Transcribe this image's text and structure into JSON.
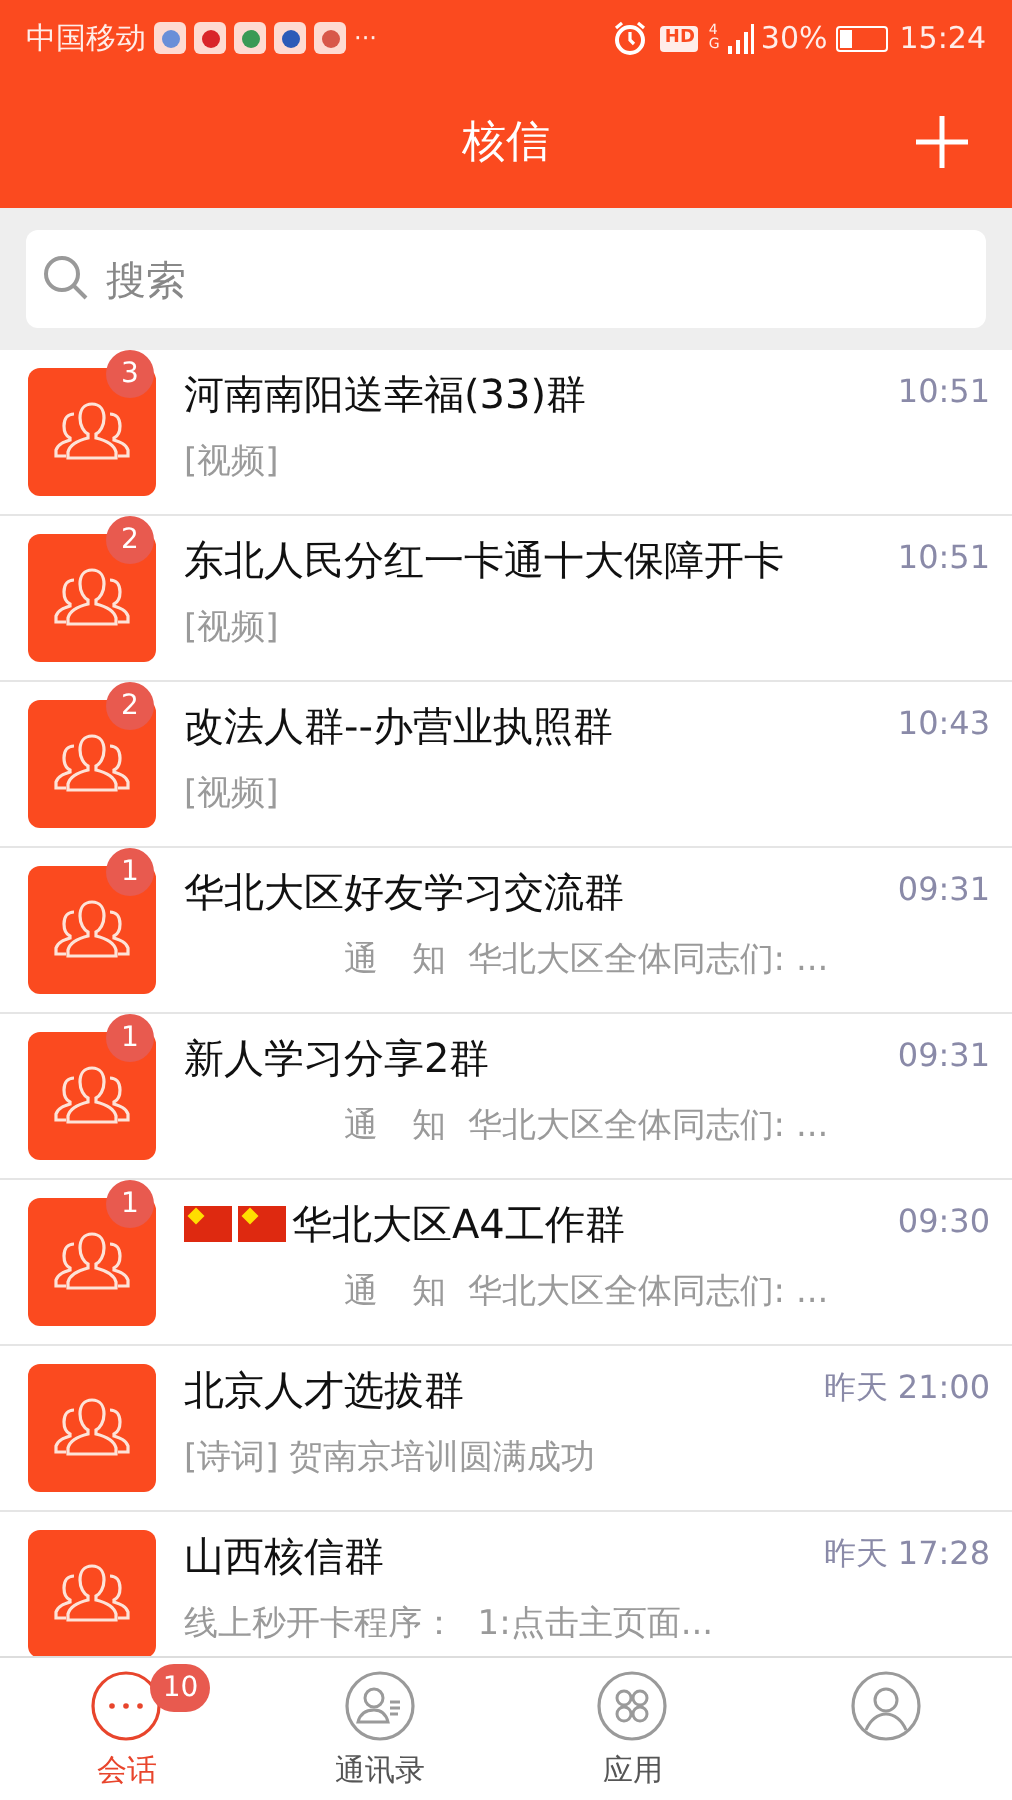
{
  "status_bar": {
    "carrier": "中国移动",
    "more": "···",
    "hd": "HD",
    "network": "4G",
    "battery_text": "30%",
    "time": "15:24"
  },
  "header": {
    "title": "核信"
  },
  "search": {
    "placeholder": "搜索"
  },
  "chats": [
    {
      "title": "河南南阳送幸福(33)群",
      "time": "10:51",
      "preview": "[视频]",
      "unread": "3",
      "flagged": false,
      "kind": "normal"
    },
    {
      "title": "东北人民分红一卡通十大保障开卡",
      "time": "10:51",
      "preview": "[视频]",
      "unread": "2",
      "flagged": false,
      "kind": "normal"
    },
    {
      "title": "改法人群--办营业执照群",
      "time": "10:43",
      "preview": "[视频]",
      "unread": "2",
      "flagged": false,
      "kind": "normal"
    },
    {
      "title": "华北大区好友学习交流群",
      "time": "09:31",
      "preview": "通　知  华北大区全体同志们: ...",
      "unread": "1",
      "flagged": false,
      "kind": "notice"
    },
    {
      "title": "新人学习分享2群",
      "time": "09:31",
      "preview": "通　知  华北大区全体同志们: ...",
      "unread": "1",
      "flagged": false,
      "kind": "notice"
    },
    {
      "title": "华北大区A4工作群",
      "time": "09:30",
      "preview": "通　知  华北大区全体同志们: ...",
      "unread": "1",
      "flagged": true,
      "kind": "notice"
    },
    {
      "title": "北京人才选拔群",
      "time": "昨天 21:00",
      "preview": "[诗词] 贺南京培训圆满成功",
      "flagged": false,
      "kind": "normal"
    },
    {
      "title": "山西核信群",
      "time": "昨天 17:28",
      "preview": "线上秒开卡程序：  1:点击主页面...",
      "flagged": false,
      "kind": "normal"
    }
  ],
  "tabs": [
    {
      "kind": "chat",
      "label": "会话",
      "badge": "10",
      "selected": true
    },
    {
      "kind": "contacts",
      "label": "通讯录",
      "selected": false
    },
    {
      "kind": "apps",
      "label": "应用",
      "selected": false
    },
    {
      "kind": "me",
      "selected": false
    }
  ]
}
